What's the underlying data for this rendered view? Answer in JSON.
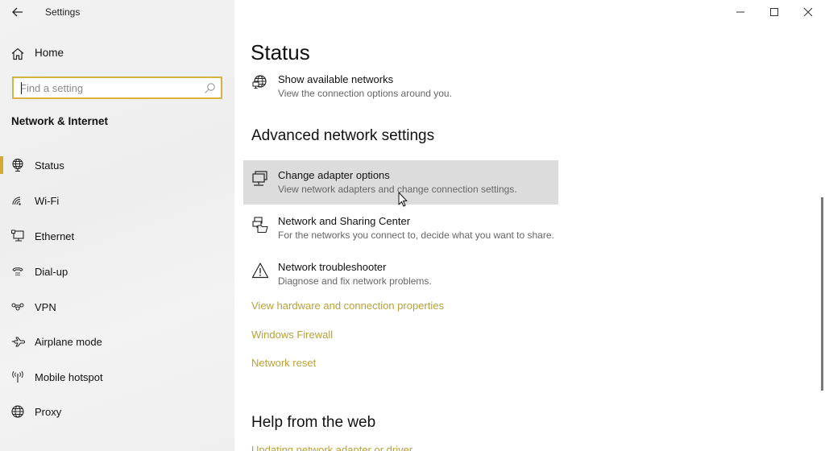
{
  "window": {
    "title": "Settings",
    "controls": {
      "minimize": "minimize",
      "maximize": "maximize",
      "close": "close"
    }
  },
  "sidebar": {
    "home_label": "Home",
    "search": {
      "placeholder": "Find a setting",
      "value": ""
    },
    "section_title": "Network & Internet",
    "accent_color": "#d4aa33",
    "items": [
      {
        "label": "Status",
        "icon": "status-globe-icon",
        "selected": true
      },
      {
        "label": "Wi-Fi",
        "icon": "wifi-icon",
        "selected": false
      },
      {
        "label": "Ethernet",
        "icon": "ethernet-icon",
        "selected": false
      },
      {
        "label": "Dial-up",
        "icon": "dialup-icon",
        "selected": false
      },
      {
        "label": "VPN",
        "icon": "vpn-icon",
        "selected": false
      },
      {
        "label": "Airplane mode",
        "icon": "airplane-icon",
        "selected": false
      },
      {
        "label": "Mobile hotspot",
        "icon": "hotspot-icon",
        "selected": false
      },
      {
        "label": "Proxy",
        "icon": "globe-icon",
        "selected": false
      }
    ]
  },
  "main": {
    "page_title": "Status",
    "show_networks": {
      "title": "Show available networks",
      "subtitle": "View the connection options around you."
    },
    "advanced_heading": "Advanced network settings",
    "advanced_items": [
      {
        "title": "Change adapter options",
        "subtitle": "View network adapters and change connection settings.",
        "icon": "adapter-icon",
        "hovered": true
      },
      {
        "title": "Network and Sharing Center",
        "subtitle": "For the networks you connect to, decide what you want to share.",
        "icon": "sharing-center-icon",
        "hovered": false
      },
      {
        "title": "Network troubleshooter",
        "subtitle": "Diagnose and fix network problems.",
        "icon": "warning-icon",
        "hovered": false
      }
    ],
    "links": [
      "View hardware and connection properties",
      "Windows Firewall",
      "Network reset"
    ],
    "help_heading": "Help from the web",
    "help_links": [
      "Updating network adapter or driver"
    ],
    "link_color": "#b8a23a"
  }
}
